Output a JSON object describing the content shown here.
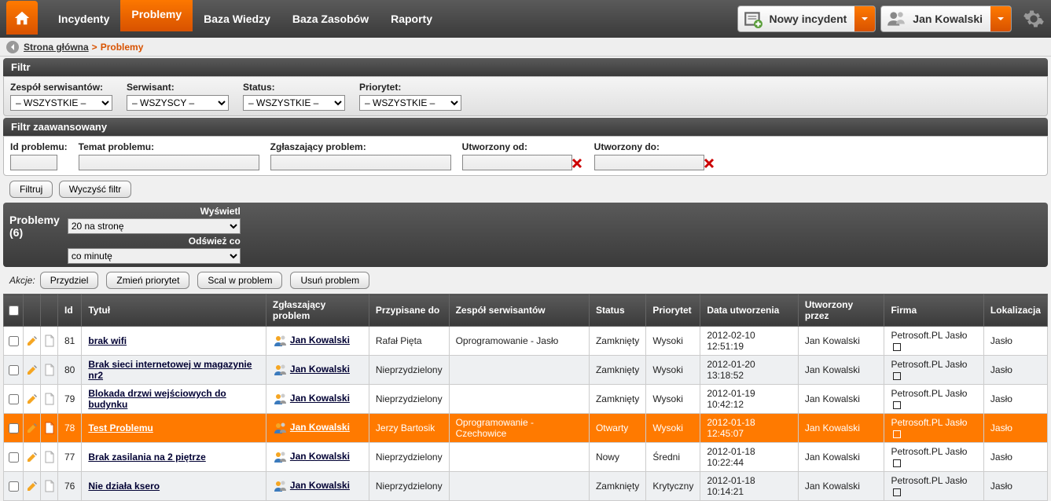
{
  "nav": {
    "items": [
      "Incydenty",
      "Problemy",
      "Baza Wiedzy",
      "Baza Zasobów",
      "Raporty"
    ],
    "active_index": 1,
    "new_incident_label": "Nowy incydent",
    "user_label": "Jan Kowalski"
  },
  "breadcrumb": {
    "home": "Strona główna",
    "sep": ">",
    "current": "Problemy"
  },
  "filter": {
    "title": "Filtr",
    "groups": {
      "team_label": "Zespół serwisantów:",
      "team_value": "– WSZYSTKIE –",
      "tech_label": "Serwisant:",
      "tech_value": "– WSZYSCY –",
      "status_label": "Status:",
      "status_value": "– WSZYSTKIE –",
      "priority_label": "Priorytet:",
      "priority_value": "– WSZYSTKIE –"
    }
  },
  "adv_filter": {
    "title": "Filtr zaawansowany",
    "id_label": "Id problemu:",
    "subject_label": "Temat problemu:",
    "reporter_label": "Zgłaszający problem:",
    "created_from_label": "Utworzony od:",
    "created_to_label": "Utworzony do:"
  },
  "buttons": {
    "filter": "Filtruj",
    "clear": "Wyczyść filtr"
  },
  "listbar": {
    "title": "Problemy",
    "count": "(6)",
    "display_label": "Wyświetl",
    "display_value": "20 na stronę",
    "refresh_label": "Odśwież co",
    "refresh_value": "co minutę"
  },
  "actions": {
    "label": "Akcje:",
    "assign": "Przydziel",
    "change_priority": "Zmień priorytet",
    "merge": "Scal w problem",
    "delete": "Usuń problem"
  },
  "columns": [
    "Id",
    "Tytuł",
    "Zgłaszający problem",
    "Przypisane do",
    "Zespół serwisantów",
    "Status",
    "Priorytet",
    "Data utworzenia",
    "Utworzony przez",
    "Firma",
    "Lokalizacja"
  ],
  "rows": [
    {
      "id": "81",
      "title": "brak wifi",
      "reporter": "Jan Kowalski",
      "assigned": "Rafał Pięta",
      "team": "Oprogramowanie - Jasło",
      "status": "Zamknięty",
      "priority": "Wysoki",
      "created": "2012-02-10 12:51:19",
      "created_by": "Jan Kowalski",
      "firm": "Petrosoft.PL Jasło",
      "loc": "Jasło",
      "hl": false,
      "alt": false
    },
    {
      "id": "80",
      "title": "Brak sieci internetowej w magazynie nr2",
      "reporter": "Jan Kowalski",
      "assigned": "Nieprzydzielony",
      "team": "",
      "status": "Zamknięty",
      "priority": "Wysoki",
      "created": "2012-01-20 13:18:52",
      "created_by": "Jan Kowalski",
      "firm": "Petrosoft.PL Jasło",
      "loc": "Jasło",
      "hl": false,
      "alt": true
    },
    {
      "id": "79",
      "title": "Blokada drzwi wejściowych do budynku",
      "reporter": "Jan Kowalski",
      "assigned": "Nieprzydzielony",
      "team": "",
      "status": "Zamknięty",
      "priority": "Wysoki",
      "created": "2012-01-19 10:42:12",
      "created_by": "Jan Kowalski",
      "firm": "Petrosoft.PL Jasło",
      "loc": "Jasło",
      "hl": false,
      "alt": false
    },
    {
      "id": "78",
      "title": "Test Problemu",
      "reporter": "Jan Kowalski",
      "assigned": "Jerzy Bartosik",
      "team": "Oprogramowanie - Czechowice",
      "status": "Otwarty",
      "priority": "Wysoki",
      "created": "2012-01-18 12:45:07",
      "created_by": "Jan Kowalski",
      "firm": "Petrosoft.PL Jasło",
      "loc": "Jasło",
      "hl": true,
      "alt": false
    },
    {
      "id": "77",
      "title": "Brak zasilania na 2 piętrze",
      "reporter": "Jan Kowalski",
      "assigned": "Nieprzydzielony",
      "team": "",
      "status": "Nowy",
      "priority": "Średni",
      "created": "2012-01-18 10:22:44",
      "created_by": "Jan Kowalski",
      "firm": "Petrosoft.PL Jasło",
      "loc": "Jasło",
      "hl": false,
      "alt": false
    },
    {
      "id": "76",
      "title": "Nie działa ksero",
      "reporter": "Jan Kowalski",
      "assigned": "Nieprzydzielony",
      "team": "",
      "status": "Zamknięty",
      "priority": "Krytyczny",
      "created": "2012-01-18 10:14:21",
      "created_by": "Jan Kowalski",
      "firm": "Petrosoft.PL Jasło",
      "loc": "Jasło",
      "hl": false,
      "alt": true
    }
  ]
}
